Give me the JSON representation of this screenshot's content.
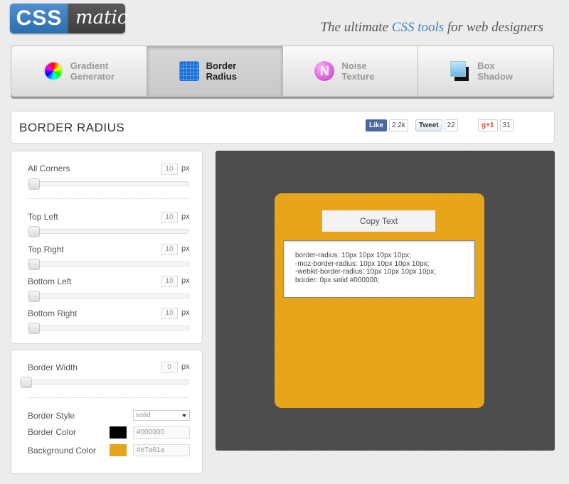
{
  "logo": {
    "part1": "CSS",
    "part2": "matic"
  },
  "tagline": {
    "before": "The ultimate ",
    "accent": "CSS tools",
    "after": " for web designers"
  },
  "tabs": [
    {
      "line1": "Gradient",
      "line2": "Generator",
      "icon": "gradient-wheel-icon"
    },
    {
      "line1": "Border",
      "line2": "Radius",
      "icon": "border-grid-icon",
      "active": true
    },
    {
      "line1": "Noise",
      "line2": "Texture",
      "icon": "noise-ball-icon"
    },
    {
      "line1": "Box",
      "line2": "Shadow",
      "icon": "box-shadow-icon"
    }
  ],
  "page_title": "BORDER RADIUS",
  "social": {
    "like_label": "Like",
    "like_count": "2.2k",
    "tweet_label": "Tweet",
    "tweet_count": "22",
    "gplus_label": "g+1",
    "gplus_count": "31"
  },
  "corners": {
    "all": {
      "label": "All Corners",
      "value": "10",
      "unit": "px"
    },
    "top_left": {
      "label": "Top Left",
      "value": "10",
      "unit": "px"
    },
    "top_right": {
      "label": "Top Right",
      "value": "10",
      "unit": "px"
    },
    "bottom_left": {
      "label": "Bottom Left",
      "value": "10",
      "unit": "px"
    },
    "bottom_right": {
      "label": "Bottom Right",
      "value": "10",
      "unit": "px"
    }
  },
  "border": {
    "width_label": "Border Width",
    "width_value": "0",
    "width_unit": "px",
    "style_label": "Border Style",
    "style_value": "solid",
    "color_label": "Border Color",
    "color_value": "#000000",
    "bg_label": "Background Color",
    "bg_value": "#e7a61a"
  },
  "preview": {
    "copy_button": "Copy Text",
    "code": [
      "border-radius: 10px 10px 10px 10px;",
      "-moz-border-radius: 10px 10px 10px 10px;",
      "-webkit-border-radius: 10px 10px 10px 10px;",
      "border: 0px solid #000000;"
    ]
  },
  "colors": {
    "accent_blue": "#3a86c9",
    "preview_fill": "#e7a61a",
    "border_swatch": "#000000",
    "preview_bg": "#4d4d4d"
  }
}
